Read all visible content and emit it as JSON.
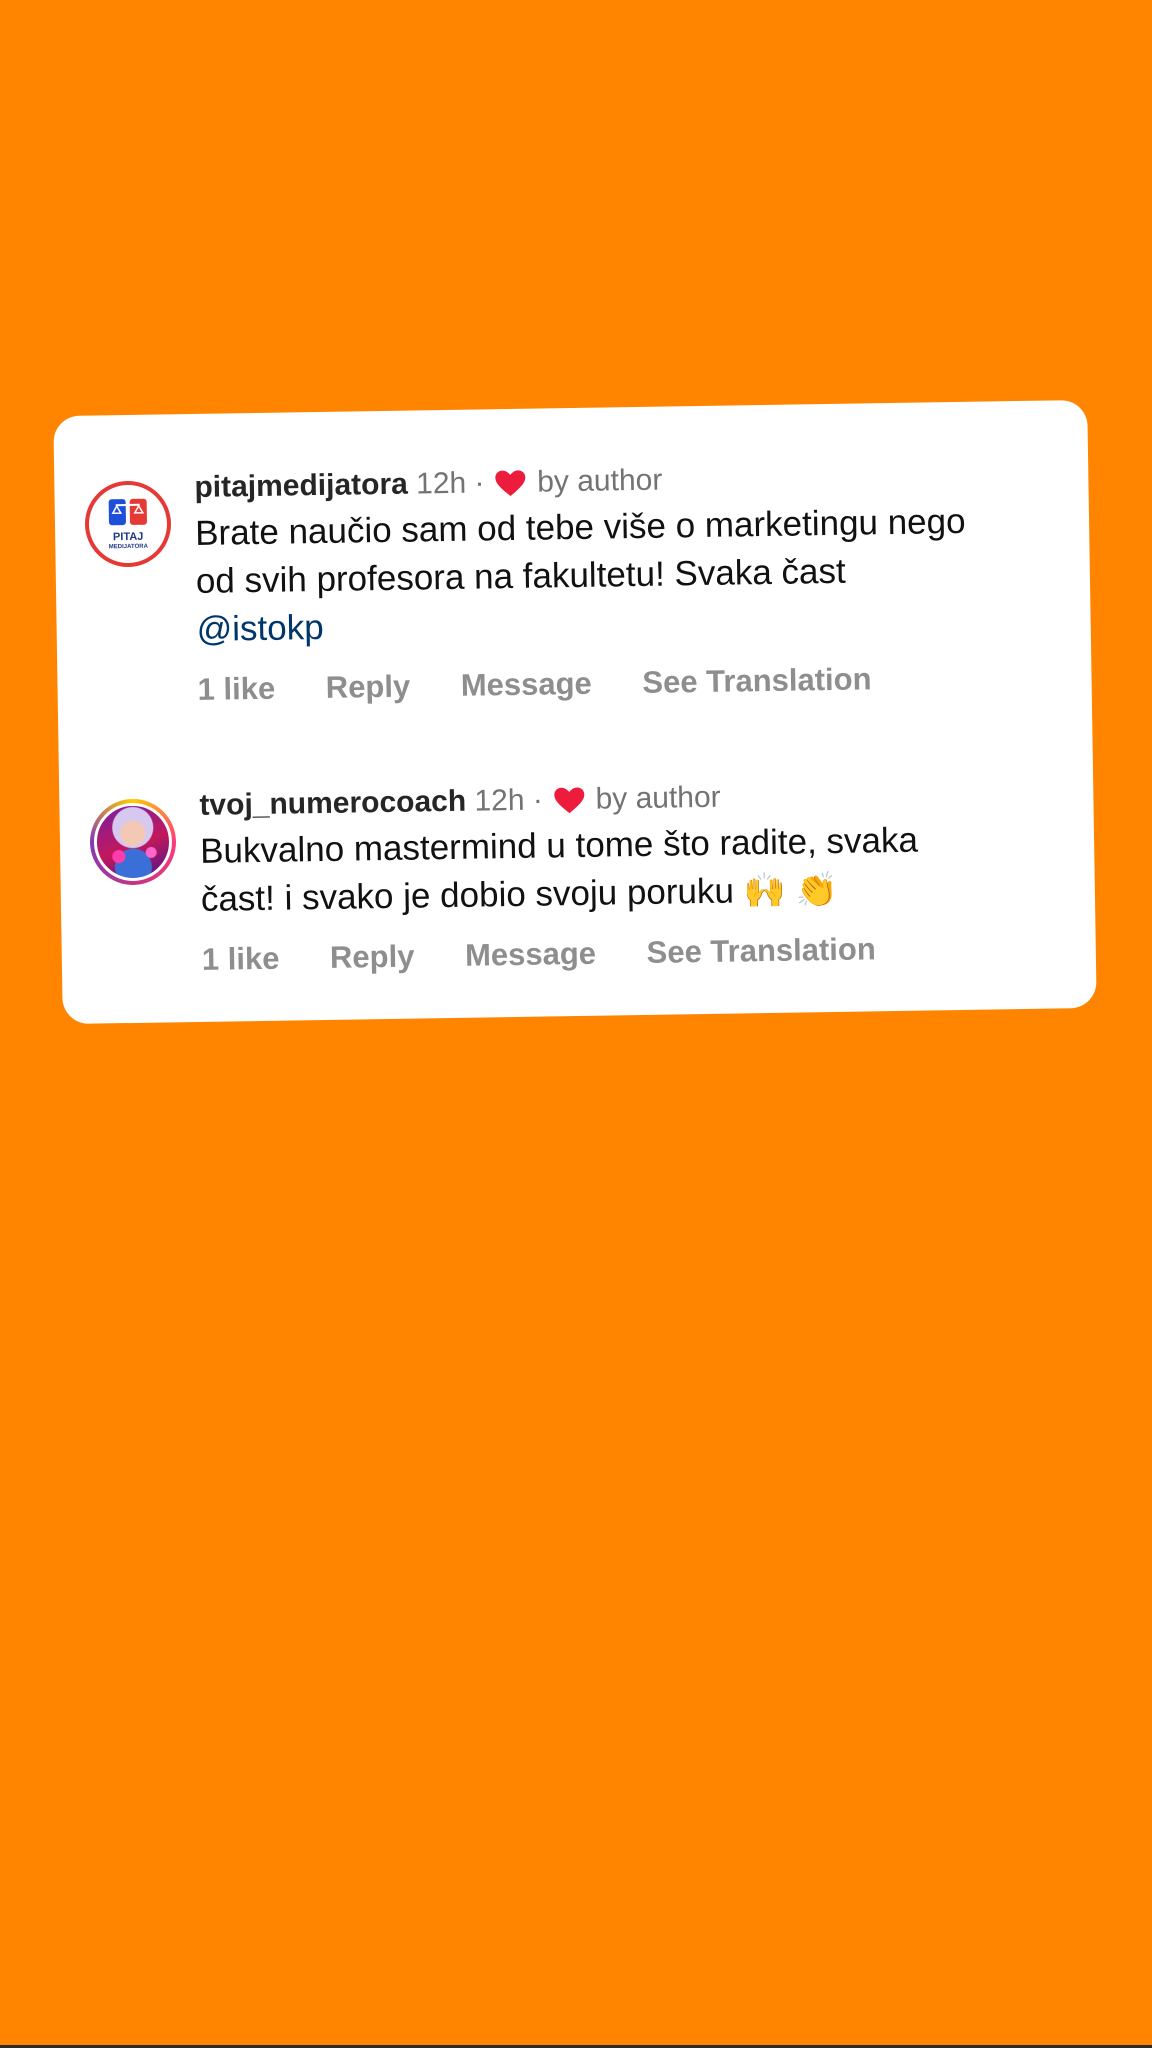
{
  "comments": [
    {
      "username": "pitajmedijatora",
      "time": "12h",
      "dot": "·",
      "liked_by": "by author",
      "text_line1": "Brate naučio sam od tebe više o marketingu nego",
      "text_line2": "od svih profesora na fakultetu! Svaka čast",
      "mention": "@istokp",
      "likes": "1 like",
      "reply": "Reply",
      "message": "Message",
      "translate": "See Translation",
      "avatar_text": "PITAJ",
      "avatar_subtext": "MEDIJATORA",
      "avatar_icon": "scales-of-justice-logo"
    },
    {
      "username": "tvoj_numerocoach",
      "time": "12h",
      "dot": "·",
      "liked_by": "by author",
      "text_line1": "Bukvalno mastermind u tome što radite, svaka",
      "text_line2": "čast! i svako je dobio svoju poruku",
      "emoji": "🙌 👏",
      "likes": "1 like",
      "reply": "Reply",
      "message": "Message",
      "translate": "See Translation",
      "avatar_icon": "profile-photo"
    }
  ],
  "colors": {
    "background": "#FF8500",
    "card": "#ffffff",
    "heart": "#ed1c3c",
    "mention": "#00376b",
    "muted": "#8e8e8e"
  }
}
